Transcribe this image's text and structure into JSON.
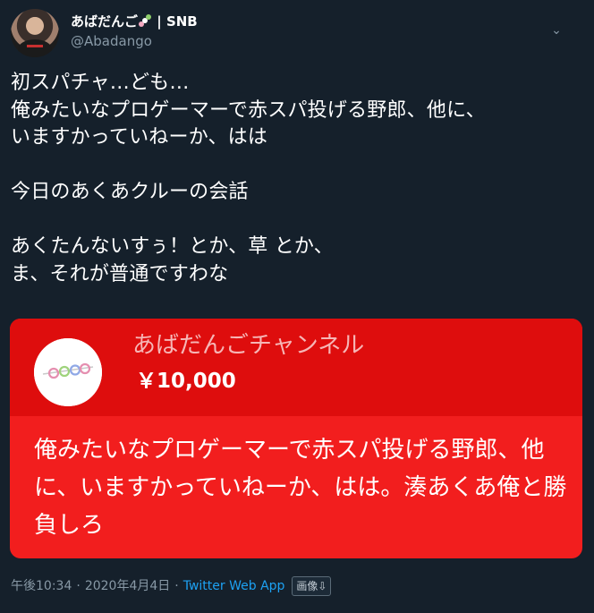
{
  "tweet": {
    "user": {
      "display_name": "あばだんご",
      "team_tag": " | SNB",
      "handle": "@Abadango"
    },
    "text": "初スパチャ…ども…\n俺みたいなプロゲーマーで赤スパ投げる野郎、他に、\nいますかっていねーか、はは\n\n今日のあくあクルーの会話\n\nあくたんないすぅ！とか、草 とか、\nま、それが普通ですわな",
    "superchat": {
      "channel": "あばだんごチャンネル",
      "amount": "￥10,000",
      "message": "俺みたいなプロゲーマーで赤スパ投げる野郎、他に、いますかっていねーか、はは。湊あくあ俺と勝負しろ",
      "colors": {
        "header_bg": "#de0d0d",
        "body_bg": "#f21e1e"
      }
    },
    "footer": {
      "time": "午後10:34",
      "separator": "·",
      "date": "2020年4月4日",
      "app": "Twitter Web App",
      "image_button": "画像⇩"
    }
  },
  "icons": {
    "name_emoji": "dango-icon",
    "menu": "chevron-down-icon"
  },
  "colors": {
    "background": "#15202b",
    "secondary_text": "#8899a6",
    "link": "#1da1f2"
  }
}
